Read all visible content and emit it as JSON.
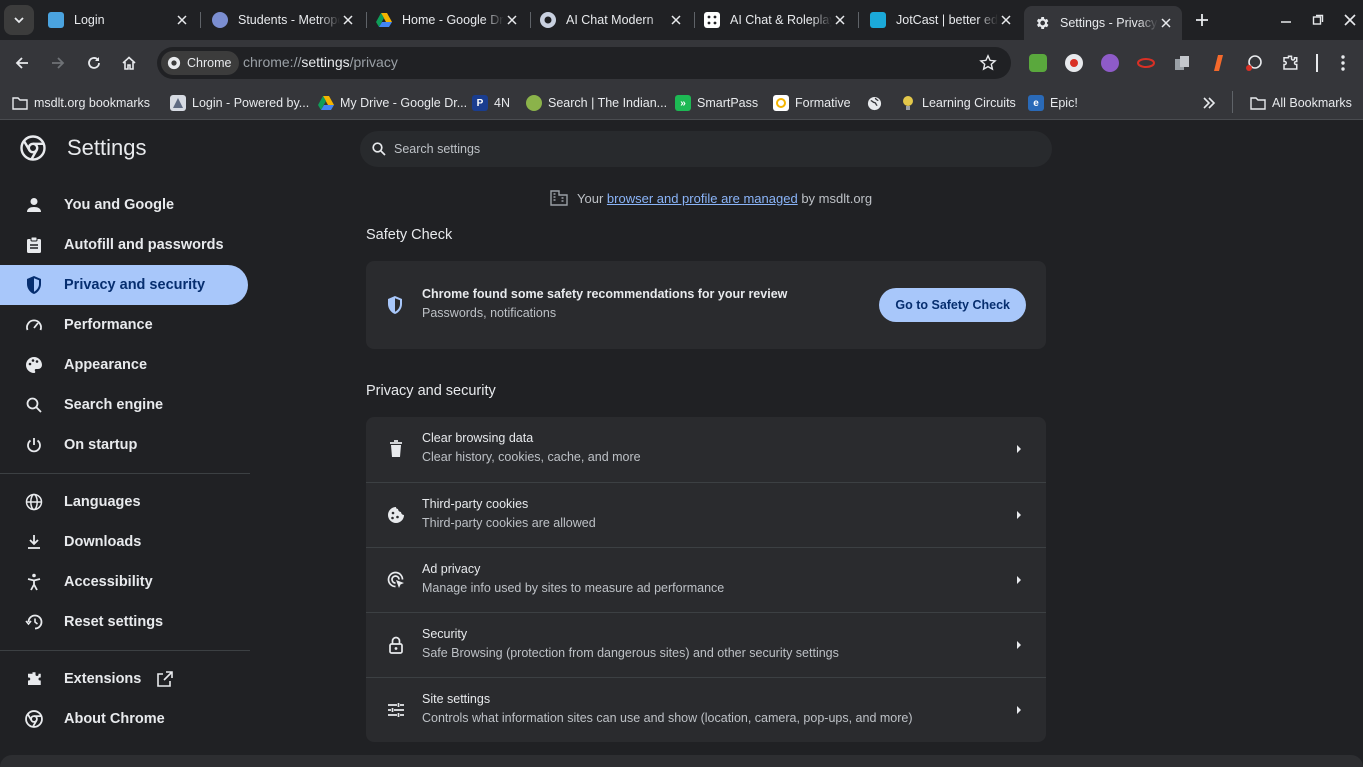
{
  "tabs": [
    {
      "title": "Login",
      "favicon": "browser-favicon-icon",
      "color": "#4aa3df"
    },
    {
      "title": "Students - Metropolitan",
      "favicon": "students-favicon-icon",
      "color": "#7b8ed1"
    },
    {
      "title": "Home - Google Drive",
      "favicon": "google-drive-icon",
      "color": "#f4b400"
    },
    {
      "title": "AI Chat Modern",
      "favicon": "chat-bubble-icon",
      "color": "#c9d1e0"
    },
    {
      "title": "AI Chat & Roleplay",
      "favicon": "dice-icon",
      "color": "#ffffff"
    },
    {
      "title": "JotCast | better education",
      "favicon": "jotcast-favicon-icon",
      "color": "#1ba9d9"
    },
    {
      "title": "Settings - Privacy and security",
      "favicon": "gear-icon",
      "color": "#e8eaed",
      "active": true
    }
  ],
  "toolbar": {
    "chip_label": "Chrome",
    "url_scheme": "chrome://",
    "url_host": "settings",
    "url_path": "/privacy"
  },
  "bookmarks": [
    {
      "label": "msdlt.org bookmarks",
      "icon": "folder-icon"
    },
    {
      "label": "Login - Powered by...",
      "icon": "login-favicon-icon"
    },
    {
      "label": "My Drive - Google Dr...",
      "icon": "google-drive-icon"
    },
    {
      "label": "4N",
      "icon": "p-favicon-icon"
    },
    {
      "label": "Search | The Indian...",
      "icon": "indian-favicon-icon"
    },
    {
      "label": "SmartPass",
      "icon": "smartpass-icon"
    },
    {
      "label": "Formative",
      "icon": "formative-icon"
    },
    {
      "label": "",
      "icon": "globe-icon"
    },
    {
      "label": "Learning Circuits",
      "icon": "lightbulb-icon"
    },
    {
      "label": "Epic!",
      "icon": "epic-icon"
    }
  ],
  "all_bookmarks_label": "All Bookmarks",
  "settings": {
    "title": "Settings",
    "search_placeholder": "Search settings",
    "nav": [
      {
        "label": "You and Google",
        "icon": "person-icon"
      },
      {
        "label": "Autofill and passwords",
        "icon": "clipboard-icon"
      },
      {
        "label": "Privacy and security",
        "icon": "shield-icon",
        "active": true
      },
      {
        "label": "Performance",
        "icon": "speedometer-icon"
      },
      {
        "label": "Appearance",
        "icon": "palette-icon"
      },
      {
        "label": "Search engine",
        "icon": "search-icon"
      },
      {
        "label": "On startup",
        "icon": "power-icon"
      }
    ],
    "nav2": [
      {
        "label": "Languages",
        "icon": "globe-icon"
      },
      {
        "label": "Downloads",
        "icon": "download-icon"
      },
      {
        "label": "Accessibility",
        "icon": "accessibility-icon"
      },
      {
        "label": "Reset settings",
        "icon": "history-icon"
      }
    ],
    "nav3": [
      {
        "label": "Extensions",
        "icon": "puzzle-icon"
      },
      {
        "label": "About Chrome",
        "icon": "chrome-icon"
      }
    ],
    "managed": {
      "prefix": "Your",
      "link": "browser and profile are managed",
      "suffix": "by msdlt.org"
    },
    "safety_check": {
      "heading": "Safety Check",
      "title": "Chrome found some safety recommendations for your review",
      "subtitle": "Passwords, notifications",
      "button": "Go to Safety Check"
    },
    "privacy": {
      "heading": "Privacy and security",
      "rows": [
        {
          "title": "Clear browsing data",
          "subtitle": "Clear history, cookies, cache, and more",
          "icon": "trash-icon"
        },
        {
          "title": "Third-party cookies",
          "subtitle": "Third-party cookies are allowed",
          "icon": "cookie-icon"
        },
        {
          "title": "Ad privacy",
          "subtitle": "Manage info used by sites to measure ad performance",
          "icon": "ad-privacy-icon"
        },
        {
          "title": "Security",
          "subtitle": "Safe Browsing (protection from dangerous sites) and other security settings",
          "icon": "lock-icon"
        },
        {
          "title": "Site settings",
          "subtitle": "Controls what information sites can use and show (location, camera, pop-ups, and more)",
          "icon": "tune-icon"
        }
      ]
    }
  }
}
